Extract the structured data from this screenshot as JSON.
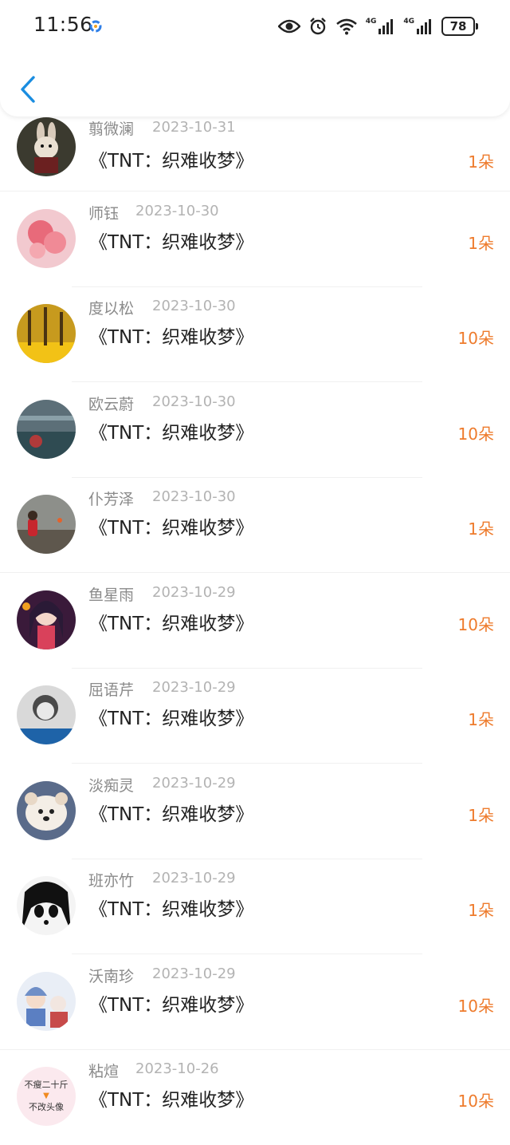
{
  "status_bar": {
    "time": "11:56",
    "network_1": "4G",
    "network_2": "4G",
    "battery": "78",
    "icons": [
      "eye-icon",
      "alarm-icon",
      "wifi-icon",
      "signal-icon",
      "signal-icon",
      "battery-icon"
    ]
  },
  "header": {
    "back_icon": "chevron-left-icon",
    "accent_color": "#1a8de0"
  },
  "colors": {
    "amount": "#ee7b2c",
    "name": "#8a8a8a",
    "date": "#b3b3b3"
  },
  "records": [
    {
      "name": "翦微澜",
      "date": "2023-10-31",
      "title": "《TNT：织难收梦》",
      "amount": "1朵"
    },
    {
      "name": "师钰",
      "date": "2023-10-30",
      "title": "《TNT：织难收梦》",
      "amount": "1朵"
    },
    {
      "name": "度以松",
      "date": "2023-10-30",
      "title": "《TNT：织难收梦》",
      "amount": "10朵"
    },
    {
      "name": "欧云蔚",
      "date": "2023-10-30",
      "title": "《TNT：织难收梦》",
      "amount": "10朵"
    },
    {
      "name": "仆芳泽",
      "date": "2023-10-30",
      "title": "《TNT：织难收梦》",
      "amount": "1朵"
    },
    {
      "name": "鱼星雨",
      "date": "2023-10-29",
      "title": "《TNT：织难收梦》",
      "amount": "10朵"
    },
    {
      "name": "屈语芹",
      "date": "2023-10-29",
      "title": "《TNT：织难收梦》",
      "amount": "1朵"
    },
    {
      "name": "淡痴灵",
      "date": "2023-10-29",
      "title": "《TNT：织难收梦》",
      "amount": "1朵"
    },
    {
      "name": "班亦竹",
      "date": "2023-10-29",
      "title": "《TNT：织难收梦》",
      "amount": "1朵"
    },
    {
      "name": "沃南珍",
      "date": "2023-10-29",
      "title": "《TNT：织难收梦》",
      "amount": "10朵"
    },
    {
      "name": "粘煊",
      "date": "2023-10-26",
      "title": "《TNT：织难收梦》",
      "amount": "10朵",
      "avatar_text": [
        "不瘦二十斤",
        "不改头像"
      ]
    }
  ]
}
